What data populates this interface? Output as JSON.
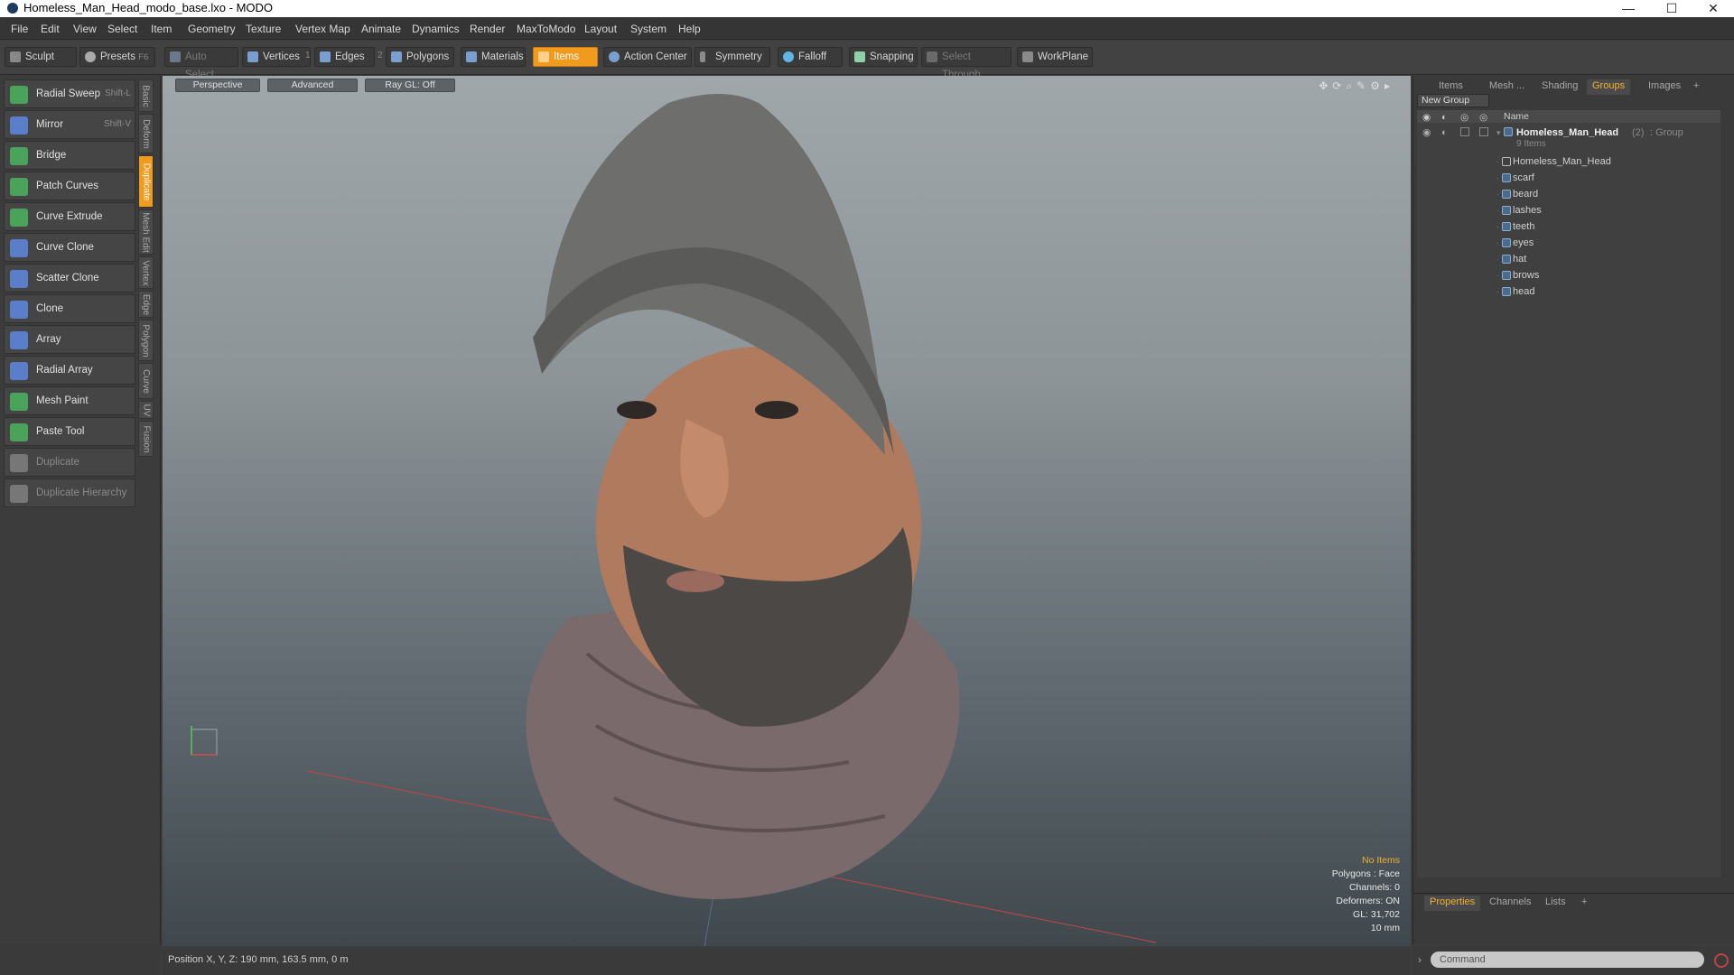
{
  "window": {
    "title": "Homeless_Man_Head_modo_base.lxo - MODO",
    "minimize": "—",
    "maximize": "☐",
    "close": "✕"
  },
  "menu": [
    "File",
    "Edit",
    "View",
    "Select",
    "Item",
    "Geometry",
    "Texture",
    "Vertex Map",
    "Animate",
    "Dynamics",
    "Render",
    "MaxToModo",
    "Layout",
    "System",
    "Help"
  ],
  "toolbar": {
    "sculpt": "Sculpt",
    "presets": "Presets",
    "presets_key": "F6",
    "auto_select": "Auto Select",
    "vertices": "Vertices",
    "vertices_num": "1",
    "edges": "Edges",
    "edges_num": "2",
    "polygons": "Polygons",
    "materials": "Materials",
    "items": "Items",
    "action_center": "Action Center",
    "symmetry": "Symmetry",
    "falloff": "Falloff",
    "snapping": "Snapping",
    "select_through": "Select Through",
    "workplane": "WorkPlane"
  },
  "tools": [
    {
      "label": "Radial Sweep",
      "shortcut": "Shift-L",
      "color": "#4aa35a"
    },
    {
      "label": "Mirror",
      "shortcut": "Shift-V",
      "color": "#5a7ec9"
    },
    {
      "label": "Bridge",
      "shortcut": "",
      "color": "#4aa35a"
    },
    {
      "label": "Patch Curves",
      "shortcut": "",
      "color": "#4aa35a"
    },
    {
      "label": "Curve Extrude",
      "shortcut": "",
      "color": "#4aa35a"
    },
    {
      "label": "Curve Clone",
      "shortcut": "",
      "color": "#5a7ec9"
    },
    {
      "label": "Scatter Clone",
      "shortcut": "",
      "color": "#5a7ec9"
    },
    {
      "label": "Clone",
      "shortcut": "",
      "color": "#5a7ec9"
    },
    {
      "label": "Array",
      "shortcut": "",
      "color": "#5a7ec9"
    },
    {
      "label": "Radial Array",
      "shortcut": "",
      "color": "#5a7ec9"
    },
    {
      "label": "Mesh Paint",
      "shortcut": "",
      "color": "#4aa35a"
    },
    {
      "label": "Paste Tool",
      "shortcut": "",
      "color": "#4aa35a"
    },
    {
      "label": "Duplicate",
      "shortcut": "",
      "color": "#777777",
      "dim": true
    },
    {
      "label": "Duplicate Hierarchy",
      "shortcut": "",
      "color": "#777777",
      "dim": true
    }
  ],
  "vtabs": [
    "Basic",
    "Deform",
    "Duplicate",
    "Mesh Edit",
    "Vertex",
    "Edge",
    "Polygon",
    "Curve",
    "UV",
    "Fusion"
  ],
  "viewport": {
    "view": "Perspective",
    "shading": "Advanced",
    "raygl": "Ray GL: Off",
    "info": {
      "items": "No Items",
      "polygons": "Polygons : Face",
      "channels": "Channels: 0",
      "deformers": "Deformers: ON",
      "gl": "GL: 31,702",
      "scale": "10 mm"
    }
  },
  "right": {
    "tabs": [
      "Items",
      "Mesh ...",
      "Shading",
      "Groups",
      "Images",
      "+"
    ],
    "new_group": "New Group",
    "name_header": "Name",
    "group": {
      "name": "Homeless_Man_Head",
      "count": "(2)",
      "type": ": Group",
      "items_count": "9 Items"
    },
    "children": [
      "Homeless_Man_Head",
      "scarf",
      "beard",
      "lashes",
      "teeth",
      "eyes",
      "hat",
      "brows",
      "head"
    ]
  },
  "bottom_tabs": [
    "Properties",
    "Channels",
    "Lists",
    "+"
  ],
  "command_placeholder": "Command",
  "status": "Position X, Y, Z:  190 mm, 163.5 mm, 0 m",
  "colors": {
    "accent": "#f09a1e",
    "highlight": "#f2b134"
  }
}
